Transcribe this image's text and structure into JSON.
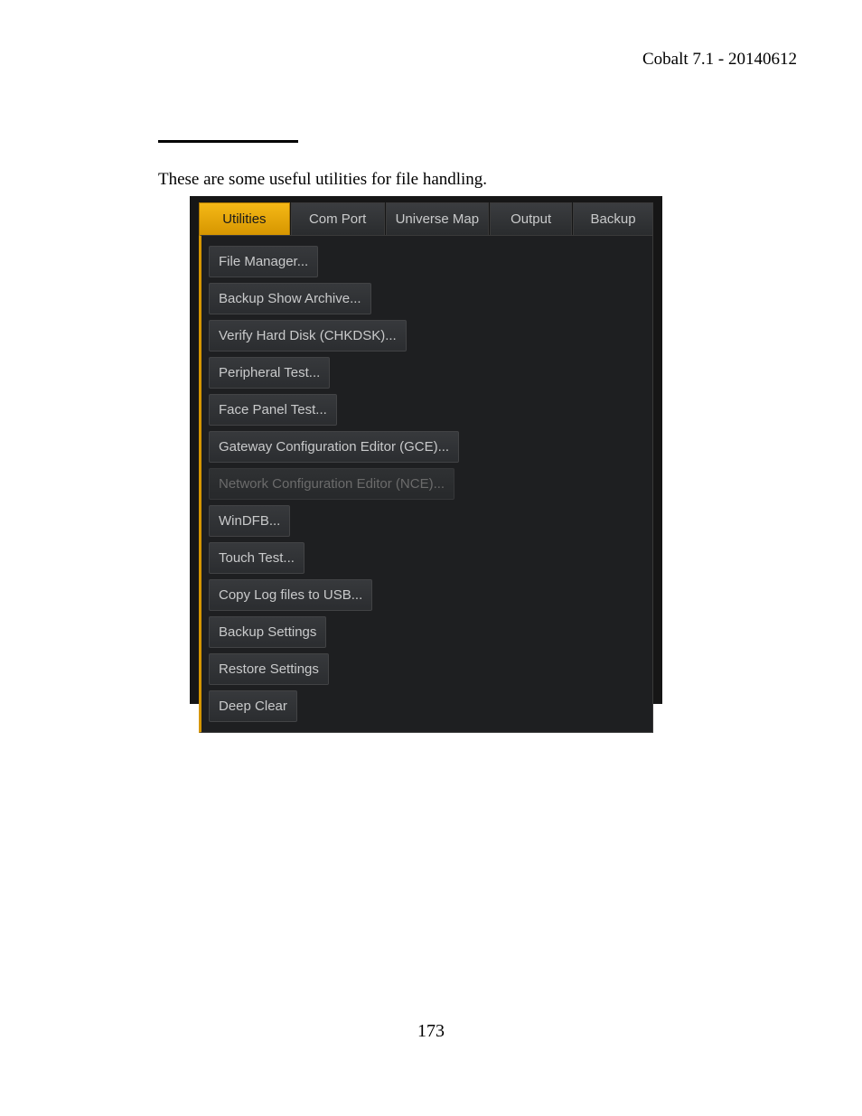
{
  "header": "Cobalt 7.1 - 20140612",
  "intro": "These are some useful utilities for file handling.",
  "tabs": [
    {
      "label": "Utilities",
      "active": true
    },
    {
      "label": "Com Port",
      "active": false
    },
    {
      "label": "Universe Map",
      "active": false
    },
    {
      "label": "Output",
      "active": false
    },
    {
      "label": "Backup",
      "active": false
    }
  ],
  "items": [
    {
      "label": "File Manager...",
      "enabled": true
    },
    {
      "label": "Backup Show Archive...",
      "enabled": true
    },
    {
      "label": "Verify Hard Disk (CHKDSK)...",
      "enabled": true
    },
    {
      "label": "Peripheral Test...",
      "enabled": true
    },
    {
      "label": "Face Panel Test...",
      "enabled": true
    },
    {
      "label": "Gateway Configuration Editor (GCE)...",
      "enabled": true
    },
    {
      "label": "Network Configuration Editor (NCE)...",
      "enabled": false
    },
    {
      "label": "WinDFB...",
      "enabled": true
    },
    {
      "label": "Touch Test...",
      "enabled": true
    },
    {
      "label": "Copy Log files to USB...",
      "enabled": true
    },
    {
      "label": "Backup Settings",
      "enabled": true
    },
    {
      "label": "Restore Settings",
      "enabled": true
    },
    {
      "label": "Deep Clear",
      "enabled": true
    }
  ],
  "page_number": "173"
}
